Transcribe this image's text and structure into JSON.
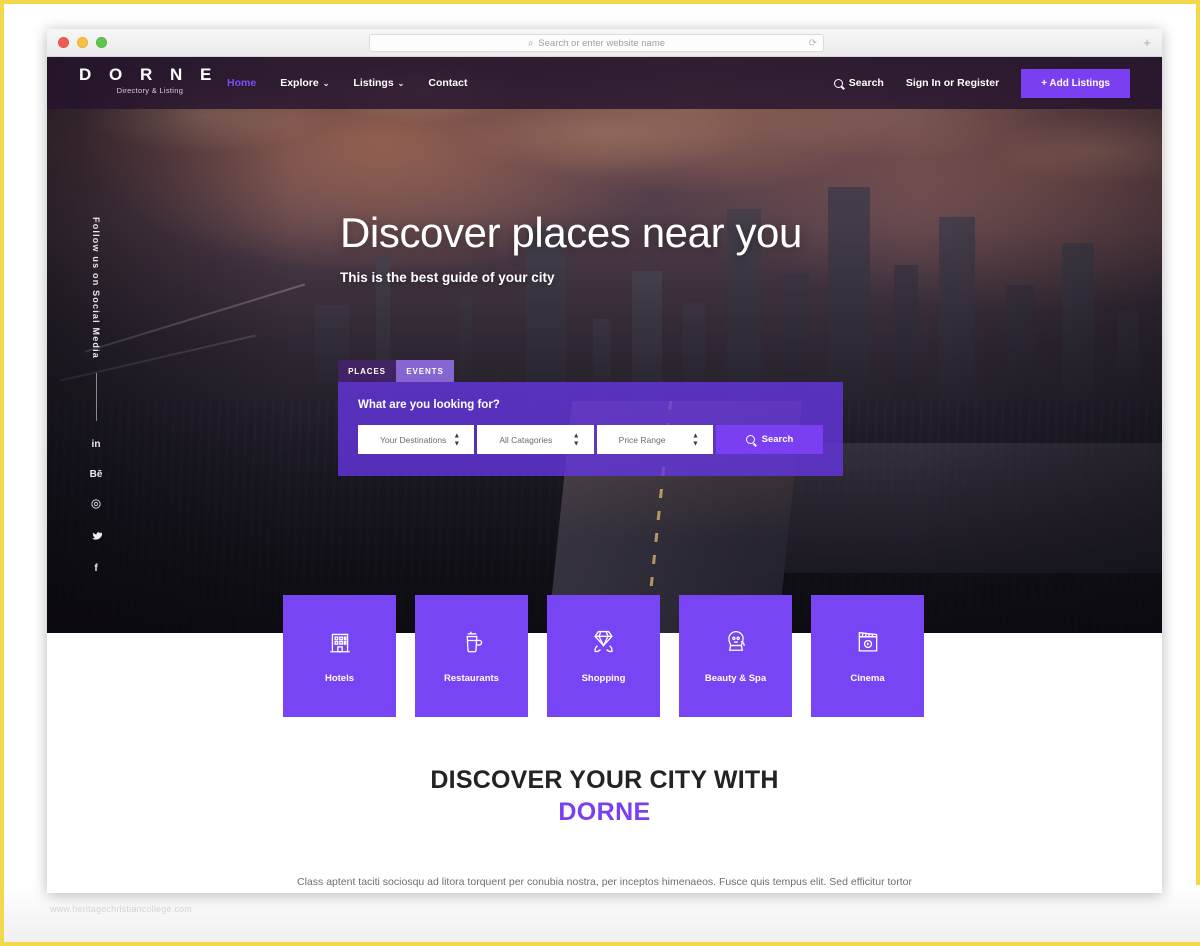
{
  "browser": {
    "address_placeholder": "Search or enter website name",
    "search_icon": "search-icon",
    "reload_icon": "reload-icon",
    "newtab_label": "+",
    "traffic_lights": [
      "close-red",
      "minimize-yellow",
      "maximize-green"
    ]
  },
  "navbar": {
    "brand_name": "D O R N E",
    "brand_tagline": "Directory & Listing",
    "links": [
      {
        "label": "Home",
        "caret": "",
        "active": true
      },
      {
        "label": "Explore",
        "caret": "⌄",
        "active": false
      },
      {
        "label": "Listings",
        "caret": "⌄",
        "active": false
      },
      {
        "label": "Contact",
        "caret": "",
        "active": false
      }
    ],
    "search_label": "Search",
    "search_icon": "magnifier-icon",
    "signin_label": "Sign In or Register",
    "add_listing_label": "+ Add Listings",
    "accent_color": "#7b3ff2",
    "active_link_color": "#7d4dfb",
    "bar_color": "#251430"
  },
  "social_rail": {
    "label": "Follow us on Social Media",
    "icons": [
      {
        "name": "linkedin-icon",
        "glyph": "in"
      },
      {
        "name": "behance-icon",
        "glyph": "Bē"
      },
      {
        "name": "instagram-icon",
        "glyph": "◎"
      },
      {
        "name": "twitter-icon",
        "glyph": "🐦"
      },
      {
        "name": "facebook-icon",
        "glyph": "f"
      }
    ]
  },
  "hero": {
    "title": "Discover places near you",
    "subtitle": "This is the best guide of your city"
  },
  "search_widget": {
    "tabs": [
      {
        "label": "PLACES",
        "active": false
      },
      {
        "label": "EVENTS",
        "active": true
      }
    ],
    "heading": "What are you looking for?",
    "fields": [
      {
        "name": "destinations-select",
        "value": "Your Destinations"
      },
      {
        "name": "categories-select",
        "value": "All Catagories"
      },
      {
        "name": "price-range-select",
        "value": "Price Range"
      }
    ],
    "search_button_label": "Search",
    "search_button_icon": "magnifier-icon",
    "panel_color": "#6436e0",
    "button_color": "#7b3ff2"
  },
  "categories": [
    {
      "label": "Hotels",
      "icon": "hotel-building-icon"
    },
    {
      "label": "Restaurants",
      "icon": "coffee-cup-icon"
    },
    {
      "label": "Shopping",
      "icon": "diamond-gem-icon"
    },
    {
      "label": "Beauty & Spa",
      "icon": "spa-face-icon"
    },
    {
      "label": "Cinema",
      "icon": "clapperboard-icon"
    }
  ],
  "category_card_color": "#7845f5",
  "discover": {
    "title": "DISCOVER YOUR CITY WITH",
    "brand": "DORNE",
    "paragraph": "Class aptent taciti sociosqu ad litora torquent per conubia nostra, per inceptos himenaeos. Fusce quis tempus elit. Sed efficitur tortor neque, vitae aliquet urna varius sit amet. Ut rhoncus, nunc nec tincidunt volutpat, ex libero."
  },
  "watermark": "www.heritagechristiancollege.com"
}
